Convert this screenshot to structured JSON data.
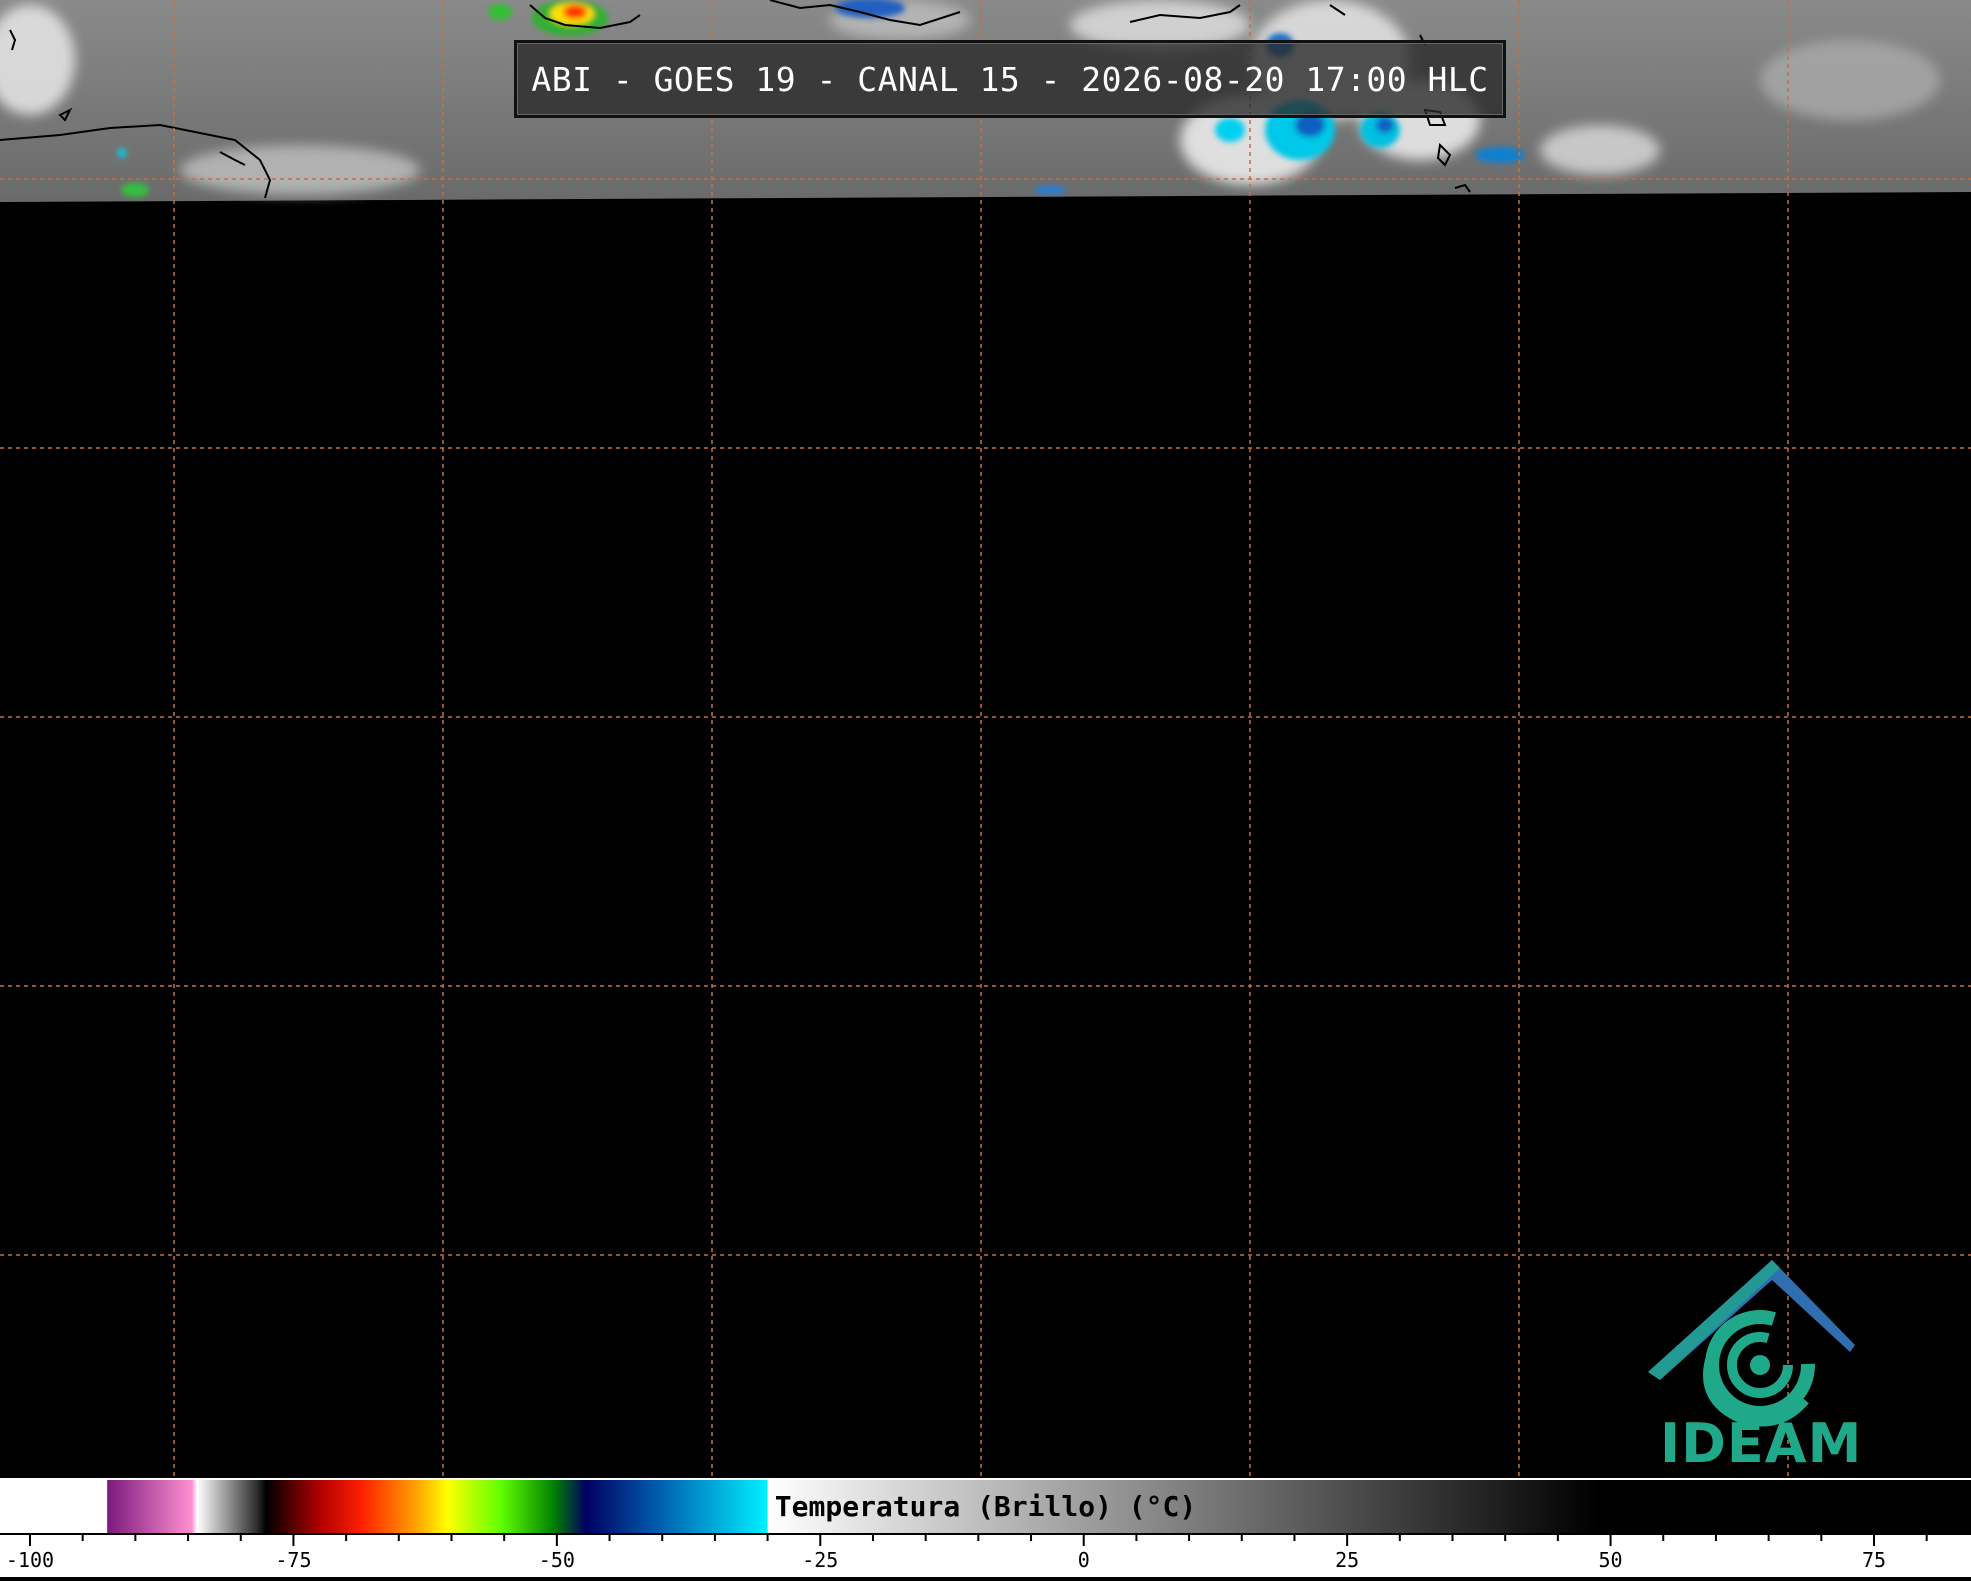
{
  "title": "ABI - GOES 19 - CANAL 15 - 2026-08-20 17:00 HLC",
  "colorbar": {
    "label": "Temperatura (Brillo) (°C)",
    "tick_labels": [
      "-100",
      "-75",
      "-50",
      "-25",
      "0",
      "25",
      "50",
      "75"
    ],
    "tick_values": [
      -100,
      -75,
      -50,
      -25,
      0,
      25,
      50,
      75
    ],
    "range": [
      -100,
      85
    ],
    "stops": [
      {
        "t": -100,
        "color": "#ffffff"
      },
      {
        "t": -90,
        "color": "#ffffff"
      },
      {
        "t": -89.9,
        "color": "#7b1a7e"
      },
      {
        "t": -82,
        "color": "#ff8fd0"
      },
      {
        "t": -81.5,
        "color": "#ffffff"
      },
      {
        "t": -76,
        "color": "#333333"
      },
      {
        "t": -75,
        "color": "#000000"
      },
      {
        "t": -70,
        "color": "#b00000"
      },
      {
        "t": -66,
        "color": "#ff2000"
      },
      {
        "t": -61,
        "color": "#ffa000"
      },
      {
        "t": -58,
        "color": "#ffff00"
      },
      {
        "t": -53,
        "color": "#60ff00"
      },
      {
        "t": -48,
        "color": "#008000"
      },
      {
        "t": -45,
        "color": "#000060"
      },
      {
        "t": -38,
        "color": "#0060b0"
      },
      {
        "t": -28,
        "color": "#00f0ff"
      },
      {
        "t": -27.9,
        "color": "#ffffff"
      },
      {
        "t": 50,
        "color": "#000000"
      },
      {
        "t": 85,
        "color": "#000000"
      }
    ]
  },
  "map": {
    "gridline_color": "#c8703a",
    "no_data_color": "#000000"
  },
  "logo": {
    "text": "IDEAM",
    "icon": "ideam-logo-icon",
    "color_primary": "#1fa88a",
    "color_secondary": "#2f6fb0"
  }
}
